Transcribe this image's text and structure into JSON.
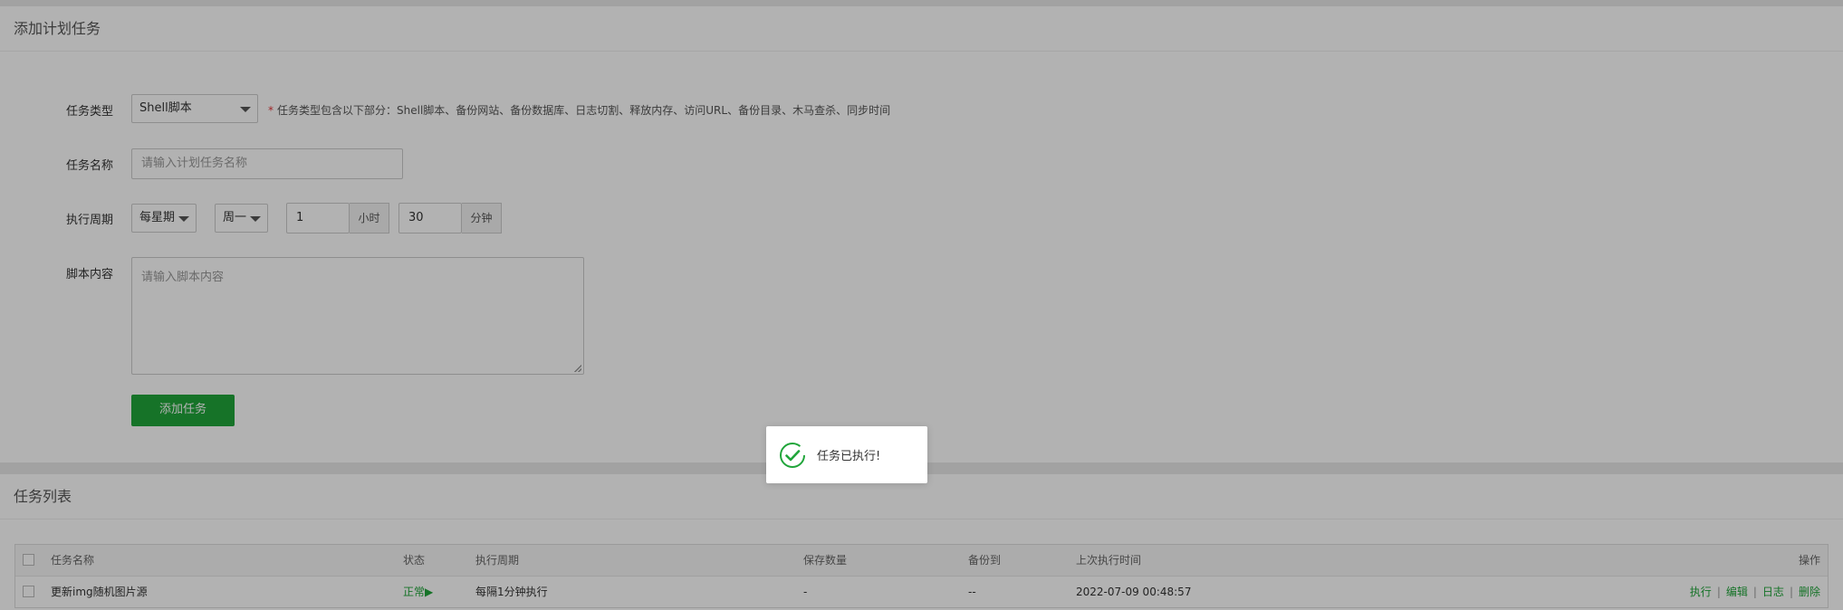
{
  "add_panel": {
    "title": "添加计划任务",
    "task_type": {
      "label": "任务类型",
      "selected": "Shell脚本",
      "hint_star": "*",
      "hint": "任务类型包含以下部分：Shell脚本、备份网站、备份数据库、日志切割、释放内存、访问URL、备份目录、木马查杀、同步时间"
    },
    "task_name": {
      "label": "任务名称",
      "placeholder": "请输入计划任务名称"
    },
    "cycle": {
      "label": "执行周期",
      "period": "每星期",
      "weekday": "周一",
      "hour_value": "1",
      "hour_unit": "小时",
      "minute_value": "30",
      "minute_unit": "分钟"
    },
    "script": {
      "label": "脚本内容",
      "placeholder": "请输入脚本内容"
    },
    "submit_label": "添加任务"
  },
  "list_panel": {
    "title": "任务列表",
    "columns": [
      "任务名称",
      "状态",
      "执行周期",
      "保存数量",
      "备份到",
      "上次执行时间",
      "操作"
    ],
    "rows": [
      {
        "name": "更新img随机图片源",
        "status": "正常▶",
        "cycle": "每隔1分钟执行",
        "save_count": "-",
        "backup_to": "--",
        "last_run": "2022-07-09 00:48:57",
        "ops": [
          "执行",
          "编辑",
          "日志",
          "删除"
        ],
        "op_sep": "|"
      }
    ]
  },
  "toast": {
    "message": "任务已执行!",
    "icon": "check-circle-icon"
  },
  "colors": {
    "accent": "#20a53a",
    "overlay": "rgba(0,0,0,0.3)"
  }
}
